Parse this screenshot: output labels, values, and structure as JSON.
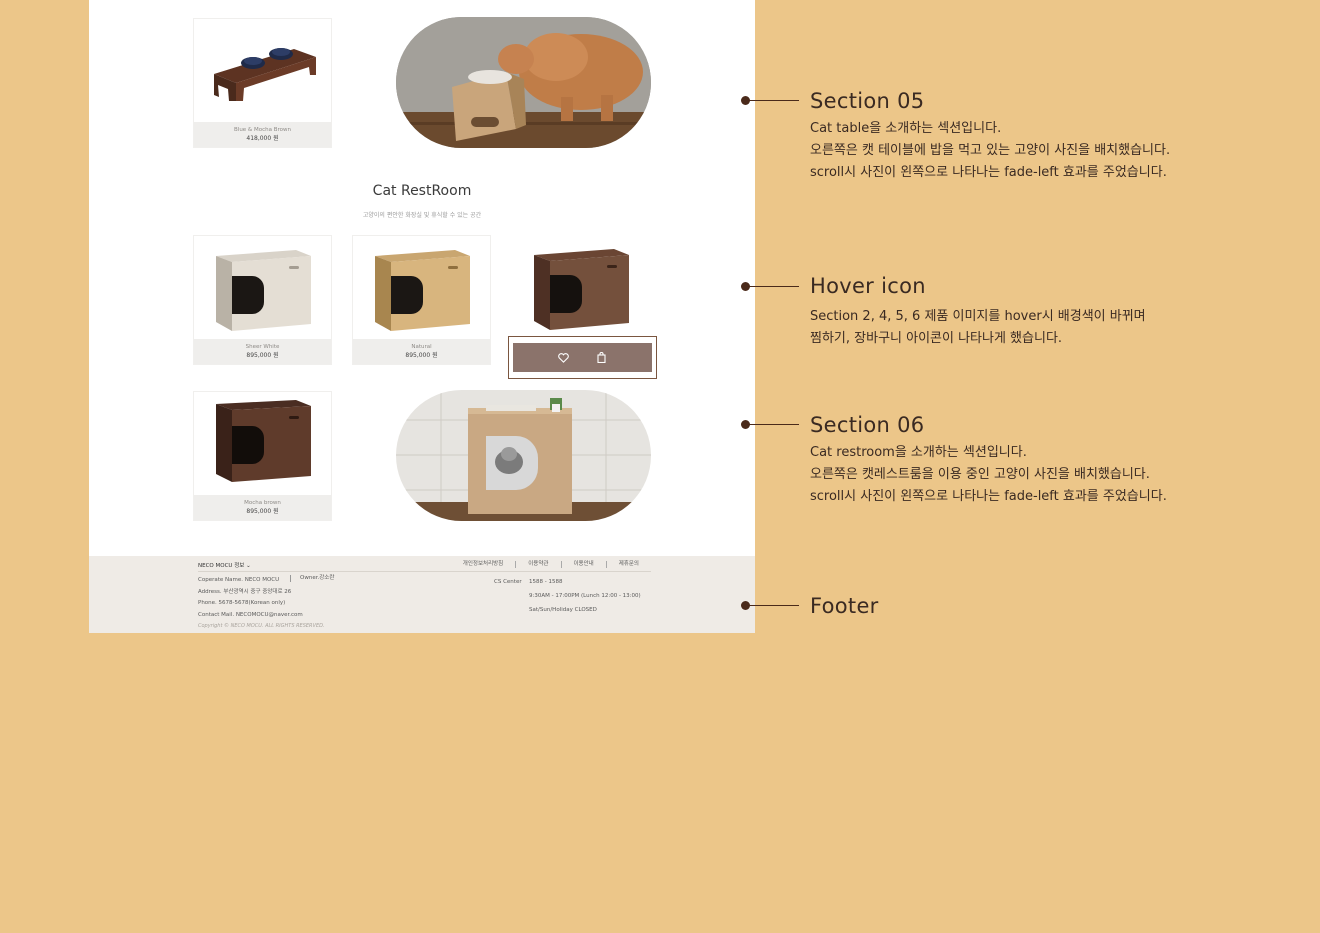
{
  "products_top": {
    "name": "Blue & Mocha Brown",
    "price": "418,000 원"
  },
  "section_restroom": {
    "title": "Cat RestRoom",
    "subtitle": "고양이의 편안한 화장실 및 휴식할 수 있는 공간",
    "items": [
      {
        "name": "Sheer White",
        "price": "895,000 원"
      },
      {
        "name": "Natural",
        "price": "895,000 원"
      },
      {
        "name": "Mocha brown",
        "price": "895,000 원"
      }
    ]
  },
  "footer": {
    "brand": "NECO MOCU 정보",
    "links": [
      "개인정보처리방침",
      "이용약관",
      "이용안내",
      "제휴문의"
    ],
    "company": "Coperate Name. NECO MOCU",
    "owner": "Owner.강소란",
    "address": "Address. 부산광역시 중구 중앙대로 26",
    "phone": "Phone. 5678-5678(Korean only)",
    "mail": "Contact Mail. NECOMOCU@naver.com",
    "cs_label": "CS Center",
    "cs_phone": "1588 - 1588",
    "cs_hours": "9:30AM - 17:00PM (Lunch 12:00 - 13:00)",
    "cs_closed": "Sat/Sun/Holiday CLOSED",
    "copyright": "Copyright © NECO MOCU. ALL RIGHTS RESERVED."
  },
  "annotations": [
    {
      "title": "Section 05",
      "lines": [
        "Cat  table을 소개하는 섹션입니다.",
        "오른쪽은 캣 테이블에 밥을 먹고 있는 고양이 사진을 배치했습니다.",
        "scroll시 사진이 왼쪽으로 나타나는 fade-left 효과를 주었습니다."
      ]
    },
    {
      "title": "Hover icon",
      "lines": [
        "Section 2, 4, 5, 6 제품 이미지를 hover시 배경색이 바뀌며",
        "찜하기, 장바구니 아이콘이 나타나게 했습니다."
      ]
    },
    {
      "title": "Section 06",
      "lines": [
        "Cat  restroom을 소개하는 섹션입니다.",
        "오른쪽은 캣레스트룸을 이용 중인 고양이 사진을 배치했습니다.",
        "scroll시 사진이 왼쪽으로 나타나는 fade-left 효과를 주었습니다."
      ]
    },
    {
      "title": "Footer",
      "lines": []
    }
  ],
  "icons": {
    "wishlist": "heart-icon",
    "cart": "shopping-bag-icon"
  },
  "colors": {
    "background": "#ecc689",
    "hover_bar": "#8b736b",
    "footer_bg": "#efebe6",
    "annotation_text": "#3a2a22"
  }
}
